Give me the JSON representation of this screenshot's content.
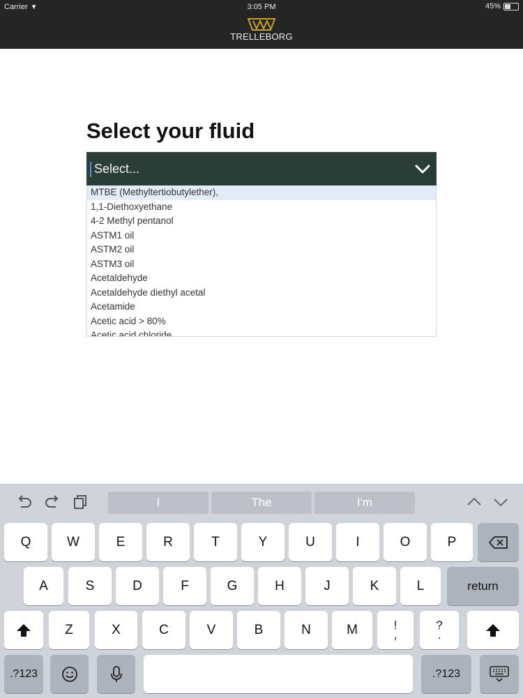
{
  "status_bar": {
    "carrier": "Carrier",
    "time": "3:05 PM",
    "battery_text": "45%",
    "battery_level": 0.45
  },
  "header": {
    "logo_text": "TRELLEBORG",
    "colors": {
      "bar": "#252525",
      "logo_gold": "#c9a227"
    }
  },
  "main": {
    "title": "Select your fluid",
    "select": {
      "placeholder": "Select...",
      "colors": {
        "background": "#2b3d37"
      },
      "options": [
        "MTBE (Methyltertiobutylether),",
        "1,1-Diethoxyethane",
        "4-2 Methyl pentanol",
        "ASTM1 oil",
        "ASTM2 oil",
        "ASTM3 oil",
        "Acetaldehyde",
        "Acetaldehyde diethyl acetal",
        "Acetamide",
        "Acetic acid > 80%",
        "Acetic acid chloride"
      ],
      "highlighted_index": 0
    }
  },
  "keyboard": {
    "toolbar_icons": [
      "undo-icon",
      "redo-icon",
      "paste-icon",
      "chevron-up-icon",
      "chevron-down-icon"
    ],
    "suggestions": [
      "I",
      "The",
      "I'm"
    ],
    "rows": {
      "row1": [
        "Q",
        "W",
        "E",
        "R",
        "T",
        "Y",
        "U",
        "I",
        "O",
        "P"
      ],
      "row2": [
        "A",
        "S",
        "D",
        "F",
        "G",
        "H",
        "J",
        "K",
        "L"
      ],
      "row3": [
        "Z",
        "X",
        "C",
        "V",
        "B",
        "N",
        "M"
      ]
    },
    "punct_keys": [
      {
        "top": "!",
        "bottom": ","
      },
      {
        "top": "?",
        "bottom": "."
      }
    ],
    "return_label": "return",
    "numbers_label": ".?123",
    "space_label": "",
    "icons": [
      "backspace-icon",
      "shift-icon",
      "emoji-icon",
      "microphone-icon",
      "keyboard-dismiss-icon"
    ]
  }
}
